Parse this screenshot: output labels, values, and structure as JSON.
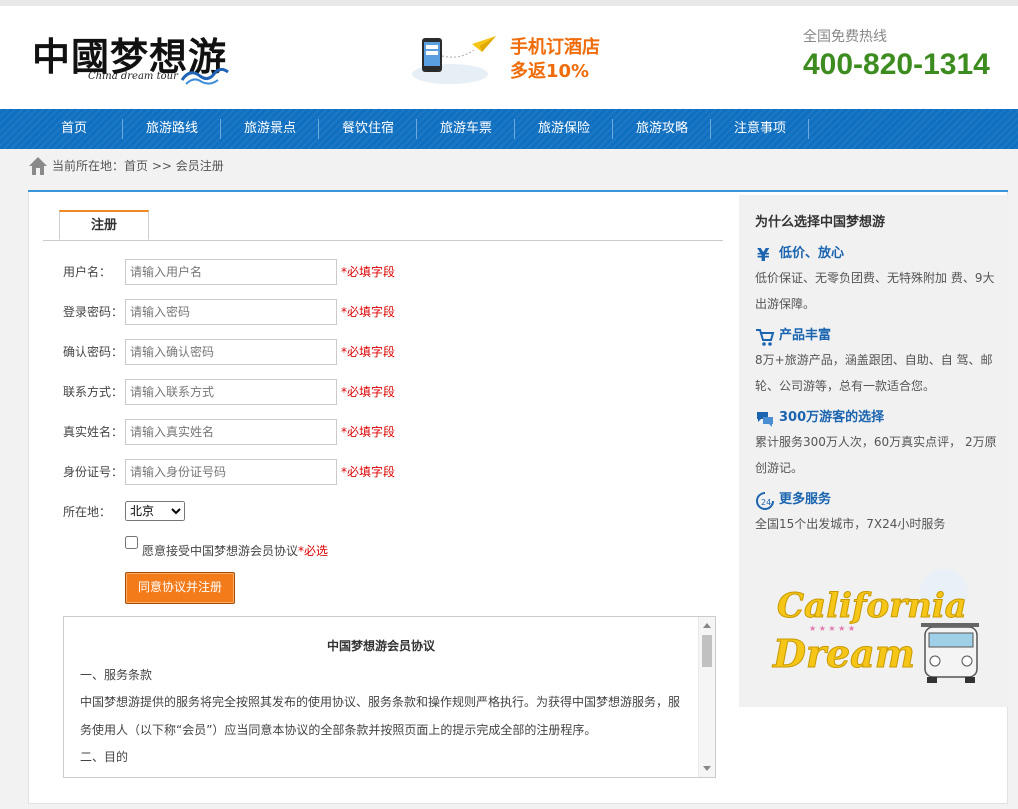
{
  "header": {
    "logo_text": "中國梦想游",
    "logo_subtitle": "China dream tour",
    "promo_line1": "手机订酒店",
    "promo_line2": "多返10%",
    "hotline_label": "全国免费热线",
    "hotline_number": "400-820-1314"
  },
  "nav": {
    "items": [
      "首页",
      "旅游路线",
      "旅游景点",
      "餐饮住宿",
      "旅游车票",
      "旅游保险",
      "旅游攻略",
      "注意事项"
    ]
  },
  "breadcrumb": {
    "text": "当前所在地：首页 >> 会员注册"
  },
  "form": {
    "tab_label": "注册",
    "required_note": "*必填字段",
    "fields": [
      {
        "label": "用户名：",
        "placeholder": "请输入用户名"
      },
      {
        "label": "登录密码：",
        "placeholder": "请输入密码"
      },
      {
        "label": "确认密码：",
        "placeholder": "请输入确认密码"
      },
      {
        "label": "联系方式：",
        "placeholder": "请输入联系方式"
      },
      {
        "label": "真实姓名：",
        "placeholder": "请输入真实姓名"
      },
      {
        "label": "身份证号：",
        "placeholder": "请输入身份证号码"
      }
    ],
    "location_label": "所在地：",
    "location_value": "北京",
    "agree_text": "愿意接受中国梦想游会员协议",
    "agree_required": "*必选",
    "submit_label": "同意协议并注册"
  },
  "agreement": {
    "title": "中国梦想游会员协议",
    "section1": "一、服务条款",
    "body": "中国梦想游提供的服务将完全按照其发布的使用协议、服务条款和操作规则严格执行。为获得中国梦想游服务，服务使用人（以下称“会员”）应当同意本协议的全部条款并按照页面上的提示完成全部的注册程序。",
    "section2": "二、目的"
  },
  "sidebar": {
    "title": "为什么选择中国梦想游",
    "features": [
      {
        "icon": "yen-icon",
        "title": "低价、放心",
        "desc": "低价保证、无零负团费、无特殊附加 费、9大出游保障。"
      },
      {
        "icon": "cart-icon",
        "title": "产品丰富",
        "desc": "8万+旅游产品，涵盖跟团、自助、自 驾、邮轮、公司游等，总有一款适合您。"
      },
      {
        "icon": "chat-icon",
        "title": "300万游客的选择",
        "desc": "累计服务300万人次，60万真实点评， 2万原创游记。"
      },
      {
        "icon": "clock-24-icon",
        "title": "更多服务",
        "desc": "全国15个出发城市，7X24小时服务"
      }
    ],
    "banner_line1": "California",
    "banner_line2": "Dream"
  },
  "colors": {
    "nav_blue": "#0f6fc0",
    "hotline_green": "#3d8c1f",
    "promo_orange": "#f06b0a",
    "button_orange": "#f37b1a",
    "required_red": "#dd0000"
  }
}
